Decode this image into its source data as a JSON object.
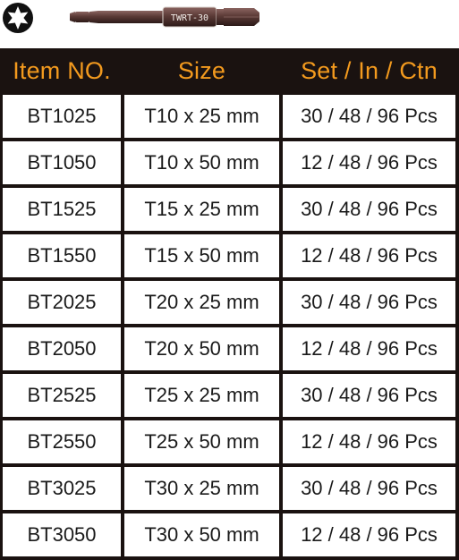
{
  "product": {
    "bit_marking": "TWRT-30",
    "icon": "torx-star-icon",
    "colors": {
      "header_background": "#1a1210",
      "header_text": "#f39a1e",
      "bit_shank": "#5b3a36",
      "grid_lines": "#1a1210"
    }
  },
  "table": {
    "headers": [
      "Item NO.",
      "Size",
      "Set / In / Ctn"
    ],
    "rows": [
      {
        "item": "BT1025",
        "size": "T10 x 25 mm",
        "packing": "30 / 48 / 96 Pcs"
      },
      {
        "item": "BT1050",
        "size": "T10 x 50 mm",
        "packing": "12 / 48 / 96 Pcs"
      },
      {
        "item": "BT1525",
        "size": "T15 x 25 mm",
        "packing": "30 / 48 / 96 Pcs"
      },
      {
        "item": "BT1550",
        "size": "T15 x 50 mm",
        "packing": "12 / 48 / 96 Pcs"
      },
      {
        "item": "BT2025",
        "size": "T20 x 25 mm",
        "packing": "30 / 48 / 96 Pcs"
      },
      {
        "item": "BT2050",
        "size": "T20 x 50 mm",
        "packing": "12 / 48 / 96 Pcs"
      },
      {
        "item": "BT2525",
        "size": "T25 x 25 mm",
        "packing": "30 / 48 / 96 Pcs"
      },
      {
        "item": "BT2550",
        "size": "T25 x 50 mm",
        "packing": "12 / 48 / 96 Pcs"
      },
      {
        "item": "BT3025",
        "size": "T30 x 25 mm",
        "packing": "30 / 48 / 96 Pcs"
      },
      {
        "item": "BT3050",
        "size": "T30 x 50 mm",
        "packing": "12 / 48 / 96 Pcs"
      }
    ]
  }
}
